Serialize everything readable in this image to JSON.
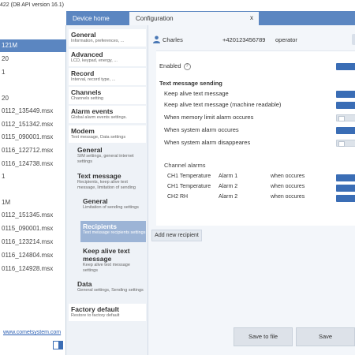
{
  "window": {
    "title": "422 (DB API version 16.1)"
  },
  "tabs": [
    {
      "label": "Device home"
    },
    {
      "label": "Configuration"
    }
  ],
  "tab_close_label": "x",
  "files": [
    {
      "label": "121M",
      "selected": true
    },
    {
      "label": "20"
    },
    {
      "label": "1"
    },
    {
      "label": ""
    },
    {
      "label": "20"
    },
    {
      "label": "0112_135449.msx"
    },
    {
      "label": "0112_151342.msx"
    },
    {
      "label": "0115_090001.msx"
    },
    {
      "label": "0116_122712.msx"
    },
    {
      "label": "0116_124738.msx"
    },
    {
      "label": "1"
    },
    {
      "label": ""
    },
    {
      "label": "1M"
    },
    {
      "label": "0112_151345.msx"
    },
    {
      "label": "0115_090001.msx"
    },
    {
      "label": "0116_123214.msx"
    },
    {
      "label": "0116_124804.msx"
    },
    {
      "label": "0116_124928.msx"
    }
  ],
  "website_link": "www.cometsystem.com",
  "nav": {
    "general": {
      "title": "General",
      "sub": "Information, preferences, ..."
    },
    "advanced": {
      "title": "Advanced",
      "sub": "LCD, keypad, energy, ..."
    },
    "record": {
      "title": "Record",
      "sub": "Interval, record type, ..."
    },
    "channels": {
      "title": "Channels",
      "sub": "Channels setting"
    },
    "alarm_events": {
      "title": "Alarm events",
      "sub": "Global alarm events settings."
    },
    "modem": {
      "title": "Modem",
      "sub": "Text message, Data settings"
    },
    "modem_general": {
      "title": "General",
      "sub": "SIM settings, general internet settings"
    },
    "text_message": {
      "title": "Text message",
      "sub": "Recipients, keep alive text message, limitation of sending"
    },
    "tm_general": {
      "title": "General",
      "sub": "Limitation of sending settings"
    },
    "recipients": {
      "title": "Recipients",
      "sub": "Text message recipients settings"
    },
    "keep_alive": {
      "title": "Keep alive text message",
      "sub": "Keep alive text message settings"
    },
    "data": {
      "title": "Data",
      "sub": "General settings, Sending settings"
    },
    "factory_default": {
      "title": "Factory default",
      "sub": "Restore to factory default"
    }
  },
  "recipient": {
    "name": "Charles",
    "phone": "+420123456789",
    "role": "operator"
  },
  "settings": {
    "enabled_label": "Enabled",
    "enabled_on": true,
    "section_title": "Text message sending",
    "options": [
      {
        "label": "Keep alive text message",
        "on": true
      },
      {
        "label": "Keep alive text message (machine readable)",
        "on": true
      },
      {
        "label": "When memory limit alarm occures",
        "on": false
      },
      {
        "label": "When system alarm occures",
        "on": true
      },
      {
        "label": "When system alarm disappeares",
        "on": false
      }
    ],
    "channel_alarms_title": "Channel alarms",
    "channel_alarms": [
      {
        "channel": "CH1 Temperature",
        "alarm": "Alarm 1",
        "when": "when occures"
      },
      {
        "channel": "CH1 Temperature",
        "alarm": "Alarm 2",
        "when": "when occures"
      },
      {
        "channel": "CH2 RH",
        "alarm": "Alarm 2",
        "when": "when occures"
      }
    ]
  },
  "buttons": {
    "add_recipient": "Add new recipient",
    "save_to_file": "Save to file",
    "save": "Save"
  },
  "colors": {
    "accent": "#5b86c1",
    "toggle_on": "#3a6db5",
    "nav_selected": "#9cb4d6"
  }
}
